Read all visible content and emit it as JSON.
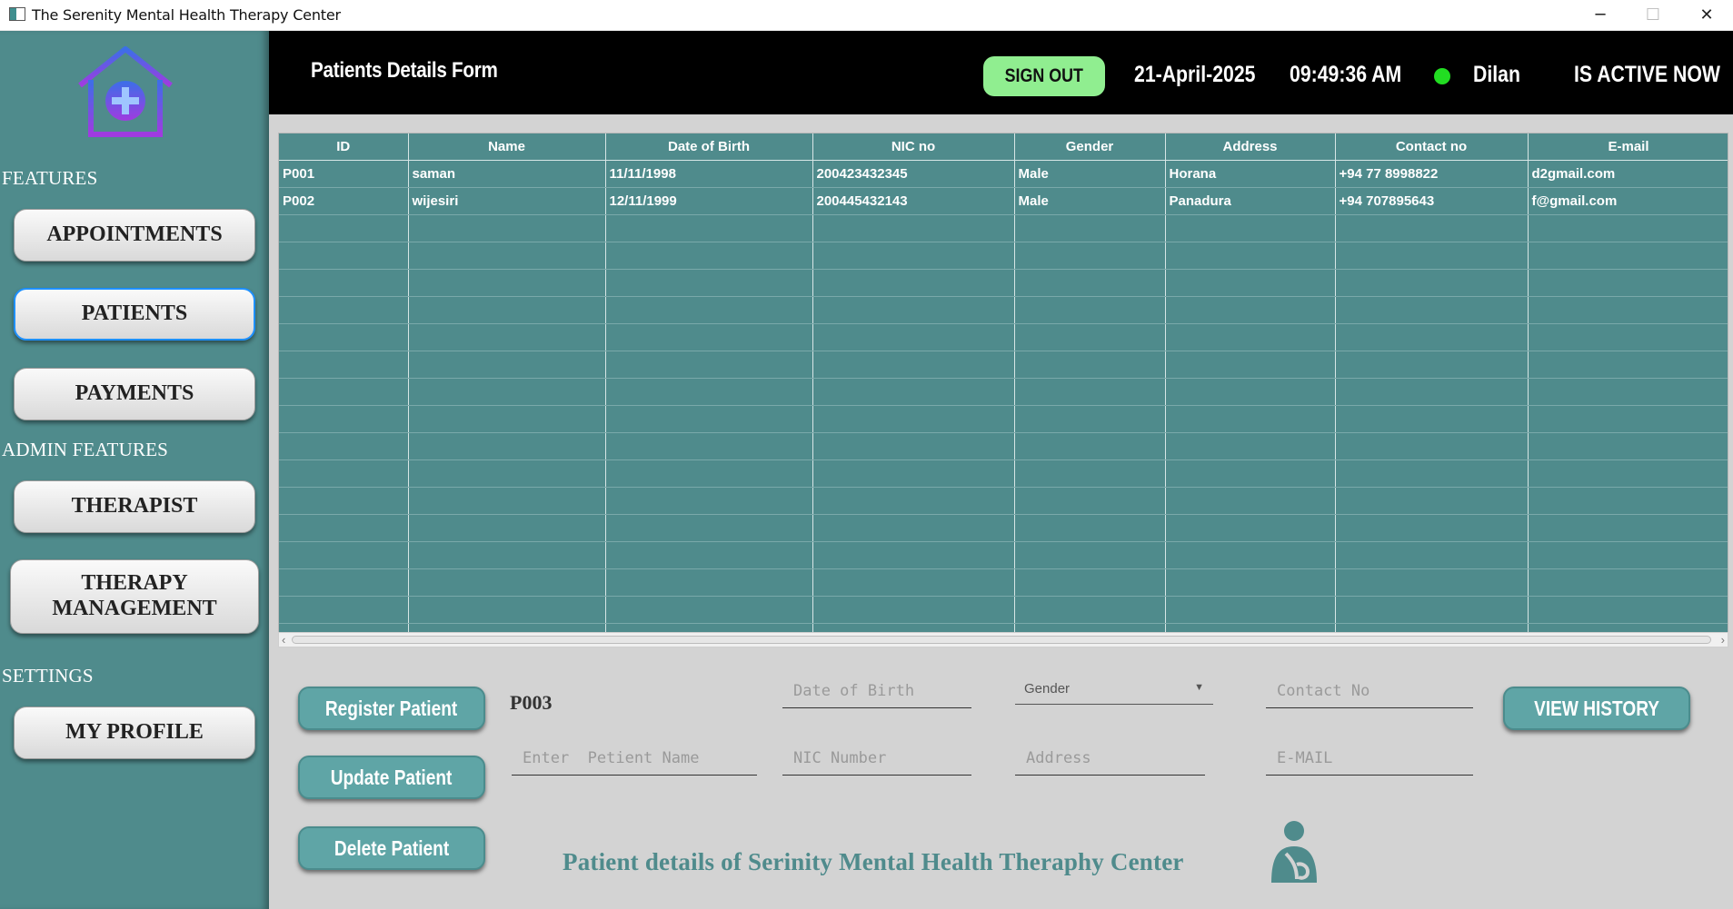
{
  "window": {
    "title": "The Serenity Mental Health Therapy Center",
    "minimize": "─",
    "maximize": "☐",
    "close": "✕"
  },
  "sidebar": {
    "features_heading": "FEATURES",
    "admin_heading": "ADMIN FEATURES",
    "settings_heading": "SETTINGS",
    "buttons": {
      "appointments": "APPOINTMENTS",
      "patients": "PATIENTS",
      "payments": "PAYMENTS",
      "therapist": "THERAPIST",
      "therapy_management_line1": "THERAPY",
      "therapy_management_line2": "MANAGEMENT",
      "my_profile": "MY PROFILE"
    },
    "active_item": "PATIENTS"
  },
  "header": {
    "form_title": "Patients Details Form",
    "sign_out": "SIGN OUT",
    "date": "21-April-2025",
    "time": "09:49:36  AM",
    "user": "Dilan",
    "status": "IS ACTIVE NOW",
    "status_color": "#22dd22"
  },
  "table": {
    "columns": [
      "ID",
      "Name",
      "Date of Birth",
      "NIC no",
      "Gender",
      "Address",
      "Contact no",
      "E-mail"
    ],
    "rows": [
      [
        "P001",
        "saman",
        "11/11/1998",
        "200423432345",
        "Male",
        "Horana",
        "+94 77 8998822",
        "d2gmail.com"
      ],
      [
        "P002",
        "wijesiri",
        "12/11/1999",
        "200445432143",
        "Male",
        "Panadura",
        "+94 707895643",
        "f@gmail.com"
      ]
    ],
    "empty_rows": 16
  },
  "form": {
    "register_button": "Register Patient",
    "update_button": "Update Patient",
    "delete_button": "Delete Patient",
    "view_history_button": "VIEW HISTORY",
    "patient_id": "P003",
    "placeholders": {
      "dob": "Date of Birth",
      "contact": "Contact No",
      "name": "Enter  Petient Name",
      "nic": "NIC Number",
      "address": "Address",
      "email": "E-MAIL"
    },
    "gender_select": "Gender"
  },
  "footer": {
    "text": "Patient details of Serinity Mental Health  Theraphy Center"
  },
  "colors": {
    "sidebar": "#4f8b8c",
    "accent_teal": "#5fa5a6",
    "signout": "#90ee90",
    "header": "#000000"
  }
}
